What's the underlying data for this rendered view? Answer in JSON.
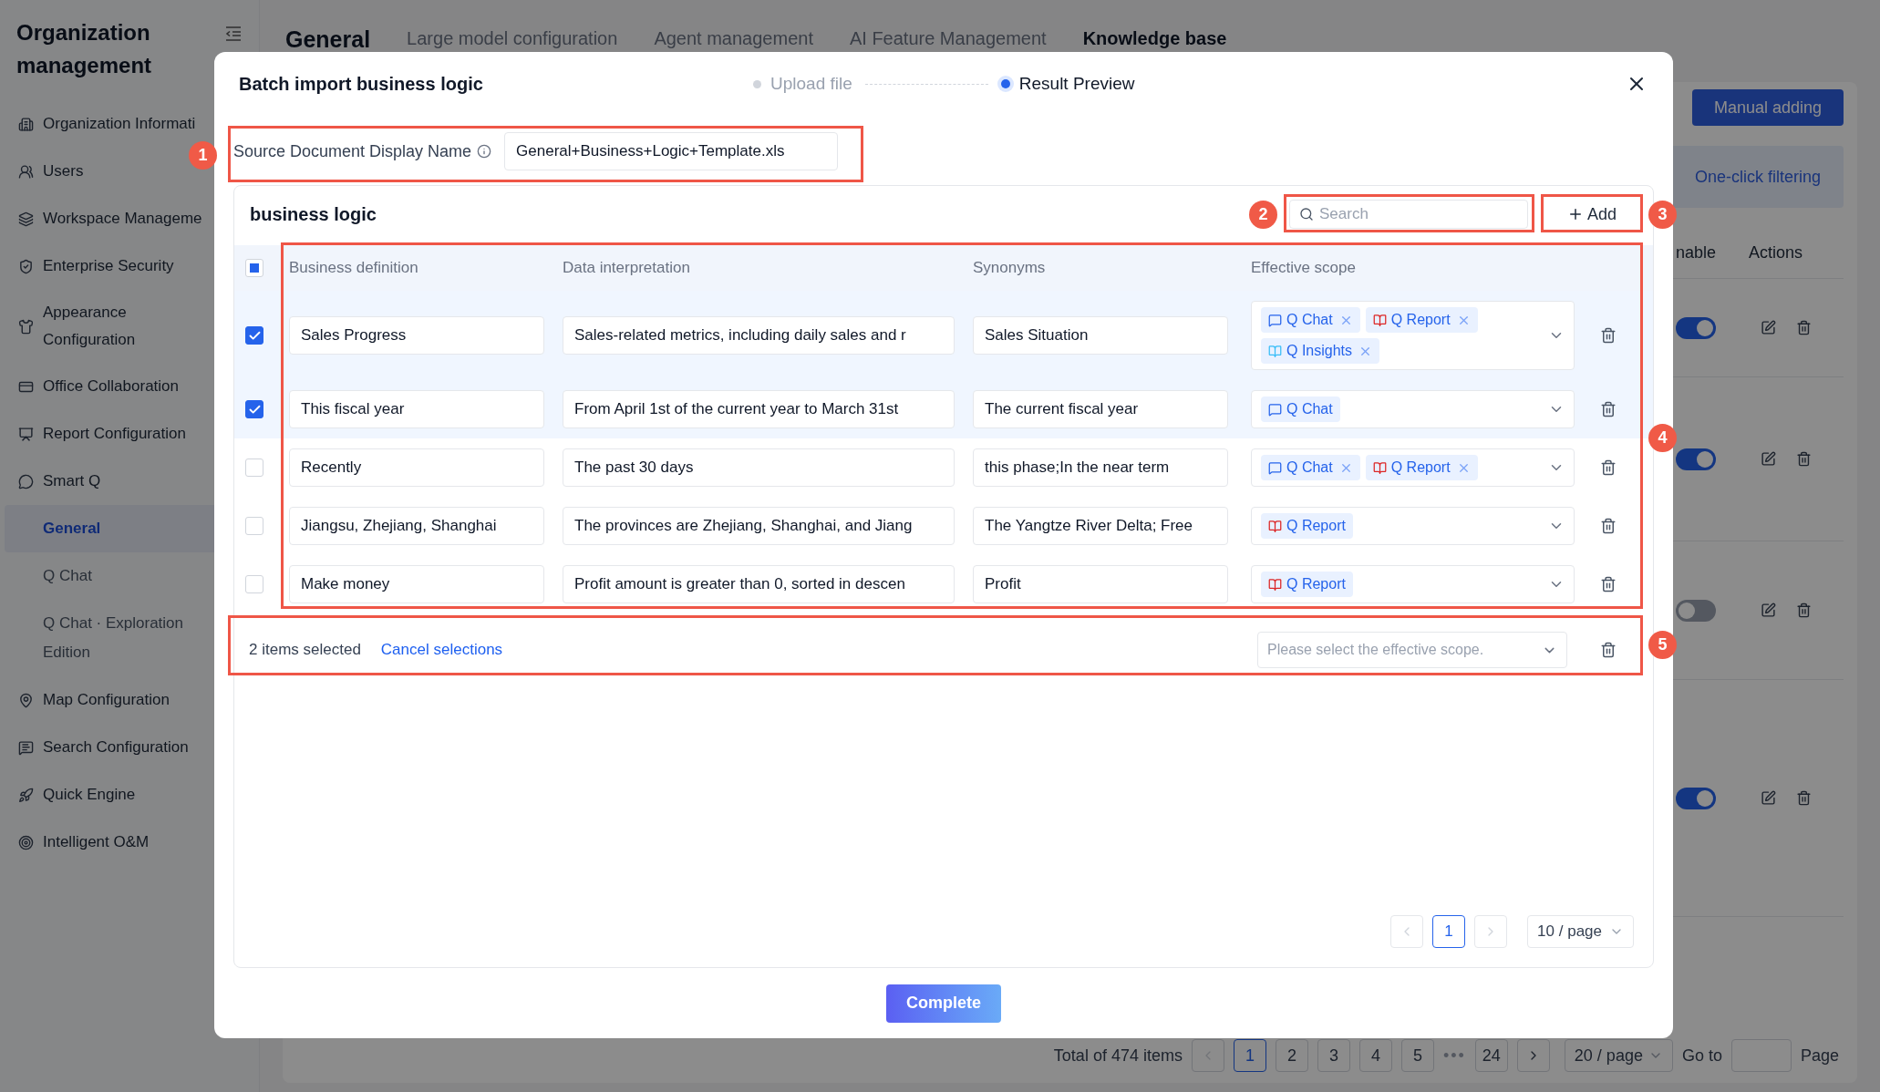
{
  "sidebar": {
    "title": "Organization management",
    "items": [
      {
        "label": "Organization Informati",
        "selected": false
      },
      {
        "label": "Users",
        "selected": false
      },
      {
        "label": "Workspace Manageme",
        "selected": false
      },
      {
        "label": "Enterprise Security",
        "selected": false
      },
      {
        "label": "Appearance Configuration",
        "selected": false
      },
      {
        "label": "Office Collaboration",
        "selected": false
      },
      {
        "label": "Report Configuration",
        "selected": false
      },
      {
        "label": "Smart Q",
        "selected": false,
        "children": [
          {
            "label": "General",
            "selected": true
          },
          {
            "label": "Q Chat",
            "selected": false
          },
          {
            "label": "Q Chat · Exploration Edition",
            "selected": false
          }
        ]
      },
      {
        "label": "Map Configuration",
        "selected": false
      },
      {
        "label": "Search Configuration",
        "selected": false
      },
      {
        "label": "Quick Engine",
        "selected": false
      },
      {
        "label": "Intelligent O&M",
        "selected": false
      }
    ]
  },
  "background": {
    "title": "General",
    "tabs": [
      {
        "label": "Large model configuration",
        "selected": false
      },
      {
        "label": "Agent management",
        "selected": false
      },
      {
        "label": "AI Feature Management",
        "selected": false
      },
      {
        "label": "Knowledge base",
        "selected": true
      }
    ],
    "manual_button": "Manual adding",
    "filter_button": "One-click filtering",
    "table": {
      "columns": [
        "nable",
        "Actions"
      ],
      "rows": [
        {
          "on": true
        },
        {
          "on": true
        },
        {
          "on": false
        },
        {
          "on": true
        }
      ]
    },
    "pagination": {
      "total": "Total of 474 items",
      "pages": [
        {
          "label": "1",
          "selected": true
        },
        {
          "label": "2",
          "selected": false
        },
        {
          "label": "3",
          "selected": false
        },
        {
          "label": "4",
          "selected": false
        },
        {
          "label": "5",
          "selected": false
        }
      ],
      "ellipsis": "•••",
      "last": "24",
      "page_size": "20 / page",
      "goto": "Go to",
      "page_word": "Page"
    }
  },
  "dialog": {
    "title": "Batch import business logic",
    "steps": [
      {
        "label": "Upload file",
        "selected": false
      },
      {
        "label": "Result Preview",
        "selected": true
      }
    ],
    "source": {
      "label": "Source Document Display Name",
      "value": "General+Business+Logic+Template.xls"
    },
    "section_title": "business logic",
    "search": {
      "placeholder": "Search"
    },
    "add_button": "Add",
    "table": {
      "header_checkbox": {
        "checked": false,
        "indeterminate": true
      },
      "columns": [
        "Business definition",
        "Data interpretation",
        "Synonyms",
        "Effective scope"
      ],
      "rows": [
        {
          "selected": true,
          "definition": "Sales Progress",
          "interpretation": "Sales-related metrics, including daily sales and r",
          "synonyms": "Sales Situation",
          "scope": [
            {
              "label": "Q Chat",
              "kind": "chat",
              "removable": true
            },
            {
              "label": "Q Report",
              "kind": "report",
              "removable": true
            },
            {
              "label": "Q Insights",
              "kind": "insights",
              "removable": true
            }
          ]
        },
        {
          "selected": true,
          "definition": "This fiscal year",
          "interpretation": "From April 1st of the current year to March 31st",
          "synonyms": "The current fiscal year",
          "scope": [
            {
              "label": "Q Chat",
              "kind": "chat",
              "removable": false
            }
          ]
        },
        {
          "selected": false,
          "definition": "Recently",
          "interpretation": "The past 30 days",
          "synonyms": "this phase;In the near term",
          "scope": [
            {
              "label": "Q Chat",
              "kind": "chat",
              "removable": true
            },
            {
              "label": "Q Report",
              "kind": "report",
              "removable": true
            }
          ]
        },
        {
          "selected": false,
          "definition": "Jiangsu, Zhejiang, Shanghai",
          "interpretation": "The provinces are Zhejiang, Shanghai, and Jiang",
          "synonyms": "The Yangtze River Delta; Free",
          "scope": [
            {
              "label": "Q Report",
              "kind": "report",
              "removable": false
            }
          ]
        },
        {
          "selected": false,
          "definition": "Make money",
          "interpretation": "Profit amount is greater than 0, sorted in descen",
          "synonyms": "Profit",
          "scope": [
            {
              "label": "Q Report",
              "kind": "report",
              "removable": false
            }
          ]
        }
      ]
    },
    "bulk": {
      "count": "2 items selected",
      "cancel": "Cancel selections",
      "scope_placeholder": "Please select the effective scope."
    },
    "pagination": {
      "pages": [
        {
          "label": "1",
          "selected": true
        }
      ],
      "page_size": "10 / page"
    },
    "complete_button": "Complete"
  },
  "annotations": [
    "1",
    "2",
    "3",
    "4",
    "5"
  ]
}
